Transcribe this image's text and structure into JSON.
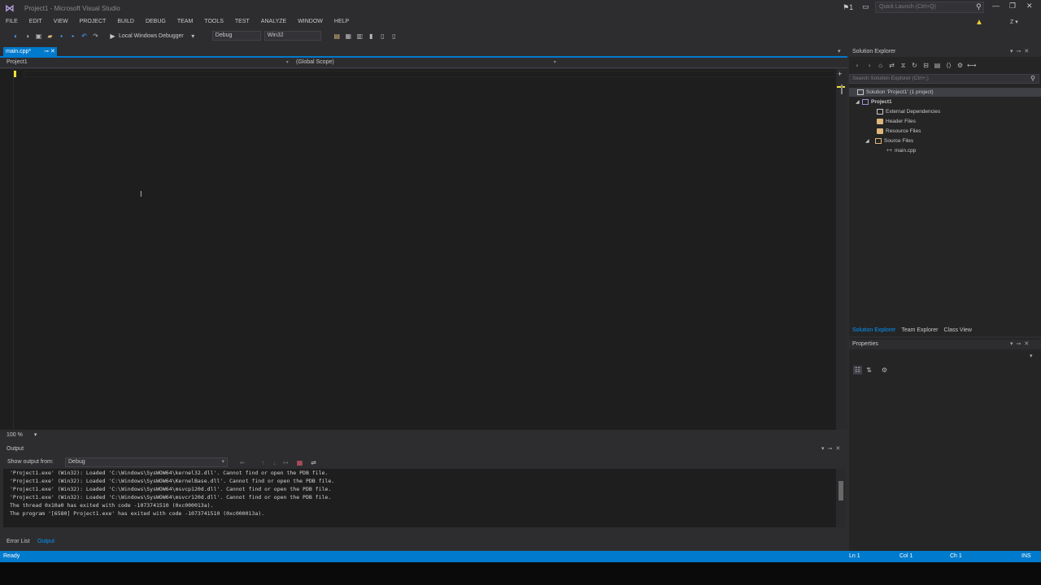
{
  "window": {
    "title": "Project1 - Microsoft Visual Studio",
    "quick_launch_placeholder": "Quick Launch (Ctrl+Q)",
    "notification_count": "1",
    "user_initial": "Z"
  },
  "menu": [
    "FILE",
    "EDIT",
    "VIEW",
    "PROJECT",
    "BUILD",
    "DEBUG",
    "TEAM",
    "TOOLS",
    "TEST",
    "ANALYZE",
    "WINDOW",
    "HELP"
  ],
  "toolbar": {
    "debugger_label": "Local Windows Debugger",
    "configuration": "Debug",
    "platform": "Win32"
  },
  "document": {
    "tab_label": "main.cpp*",
    "nav_project": "Project1",
    "nav_scope": "(Global Scope)",
    "zoom": "100 %"
  },
  "output": {
    "title": "Output",
    "show_from_label": "Show output from:",
    "source": "Debug",
    "lines": [
      "'Project1.exe' (Win32): Loaded 'C:\\Windows\\SysWOW64\\kernel32.dll'. Cannot find or open the PDB file.",
      "'Project1.exe' (Win32): Loaded 'C:\\Windows\\SysWOW64\\KernelBase.dll'. Cannot find or open the PDB file.",
      "'Project1.exe' (Win32): Loaded 'C:\\Windows\\SysWOW64\\msvcp120d.dll'. Cannot find or open the PDB file.",
      "'Project1.exe' (Win32): Loaded 'C:\\Windows\\SysWOW64\\msvcr120d.dll'. Cannot find or open the PDB file.",
      "The thread 0x10a0 has exited with code -1073741510 (0xc000013a).",
      "The program '[6580] Project1.exe' has exited with code -1073741510 (0xc000013a)."
    ],
    "tabs": [
      "Error List",
      "Output"
    ]
  },
  "solution_explorer": {
    "title": "Solution Explorer",
    "search_placeholder": "Search Solution Explorer (Ctrl+;)",
    "solution": "Solution 'Project1' (1 project)",
    "project": "Project1",
    "nodes": [
      "External Dependencies",
      "Header Files",
      "Resource Files",
      "Source Files"
    ],
    "file": "main.cpp",
    "tabs": [
      "Solution Explorer",
      "Team Explorer",
      "Class View"
    ]
  },
  "properties": {
    "title": "Properties"
  },
  "status": {
    "ready": "Ready",
    "ln": "Ln 1",
    "col": "Col 1",
    "ch": "Ch 1",
    "ins": "INS"
  },
  "colors": {
    "accent": "#007acc",
    "editor_bg": "#1e1e1e",
    "chrome_bg": "#2d2d30"
  }
}
